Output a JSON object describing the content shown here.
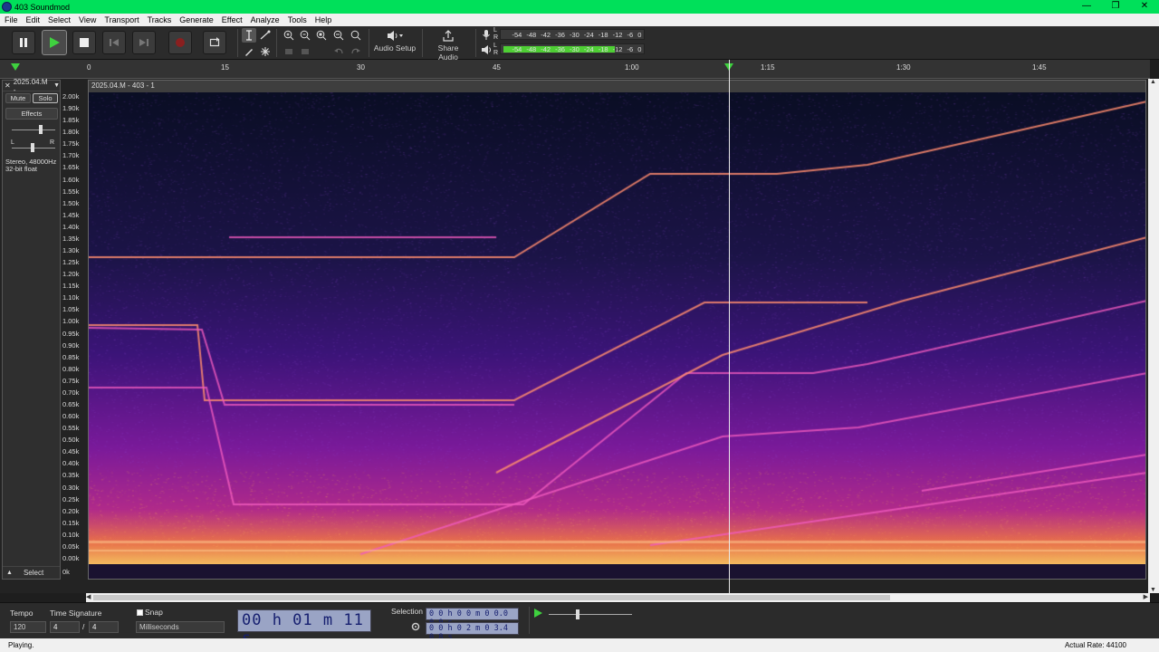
{
  "window": {
    "title": "403 Soundmod",
    "controls": [
      "—",
      "❐",
      "✕"
    ]
  },
  "menu": [
    "File",
    "Edit",
    "Select",
    "View",
    "Transport",
    "Tracks",
    "Generate",
    "Effect",
    "Analyze",
    "Tools",
    "Help"
  ],
  "toolbar": {
    "audio_setup_label": "Audio Setup",
    "share_audio_label": "Share Audio",
    "record_meter_ticks": [
      "-54",
      "-48",
      "-42",
      "-36",
      "-30",
      "-24",
      "-18",
      "-12",
      "-6",
      "0"
    ],
    "play_meter_ticks": [
      "-54",
      "-48",
      "-42",
      "-36",
      "-30",
      "-24",
      "-18",
      "-12",
      "-6",
      "0"
    ],
    "play_meter_level": 0.82,
    "channel_left": "L",
    "channel_right": "R"
  },
  "ruler": {
    "ticks": [
      "0",
      "15",
      "30",
      "45",
      "1:00",
      "1:15",
      "1:30",
      "1:45"
    ]
  },
  "track": {
    "name": "2025.04.M -",
    "mute": "Mute",
    "solo": "Solo",
    "effects": "Effects",
    "pan_left": "L",
    "pan_right": "R",
    "format_line1": "Stereo, 48000Hz",
    "format_line2": "32-bit float",
    "select": "Select",
    "clip_title": "2025.04.M - 403 - 1",
    "freq_labels": [
      "2.00k",
      "1.90k",
      "1.85k",
      "1.80k",
      "1.75k",
      "1.70k",
      "1.65k",
      "1.60k",
      "1.55k",
      "1.50k",
      "1.45k",
      "1.40k",
      "1.35k",
      "1.30k",
      "1.25k",
      "1.20k",
      "1.15k",
      "1.10k",
      "1.05k",
      "1.00k",
      "0.95k",
      "0.90k",
      "0.85k",
      "0.80k",
      "0.75k",
      "0.70k",
      "0.65k",
      "0.60k",
      "0.55k",
      "0.50k",
      "0.45k",
      "0.40k",
      "0.35k",
      "0.30k",
      "0.25k",
      "0.20k",
      "0.15k",
      "0.10k",
      "0.05k",
      "0.00k"
    ],
    "bottom_label": "0k",
    "playhead_time": "1:11"
  },
  "bottom": {
    "tempo_label": "Tempo",
    "tempo_value": "120",
    "time_sig_label": "Time Signature",
    "time_sig_num": "4",
    "time_sig_sep": "/",
    "time_sig_den": "4",
    "snap_label": "Snap",
    "snap_value": "Milliseconds",
    "time_display": "00 h 01 m 11 s",
    "selection_label": "Selection",
    "sel_start": "0 0 h 0 0 m 0 0.0 0 0 s",
    "sel_end": "0 0 h 0 2 m 0 3.4 0 8 s"
  },
  "status": {
    "left": "Playing.",
    "right": "Actual Rate: 44100"
  },
  "colors": {
    "titlebar": "#00e05a",
    "accent_play": "#3fd13f",
    "meter_green": "#4ecf34",
    "time_bg": "#9aa4c5"
  }
}
